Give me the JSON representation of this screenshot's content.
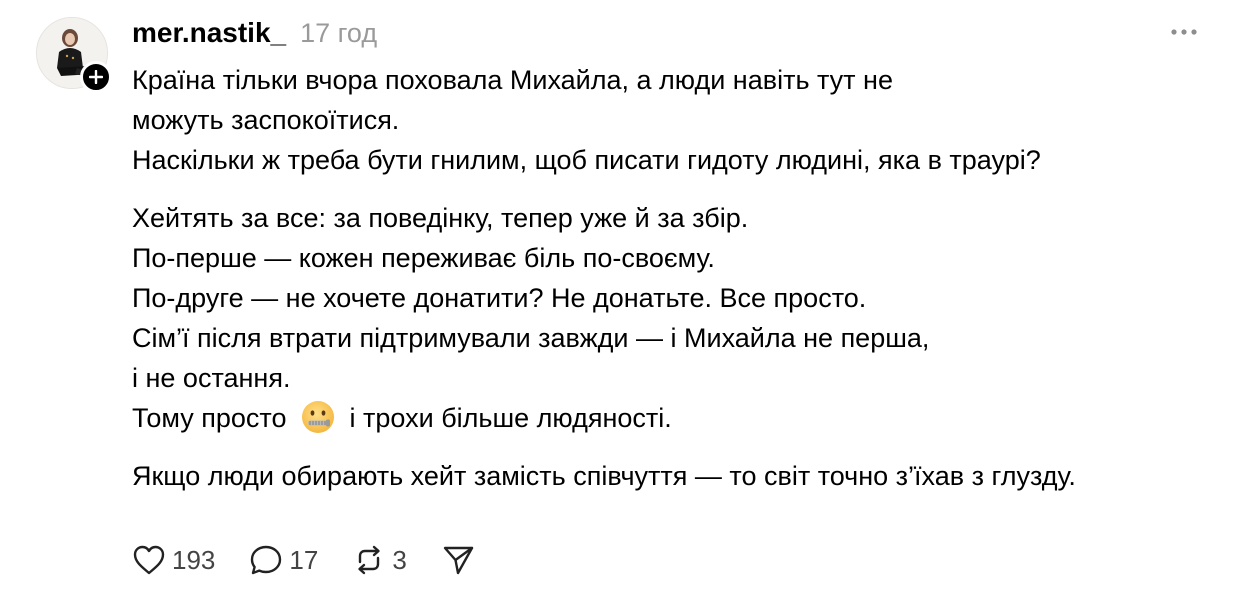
{
  "post": {
    "username": "mer.nastik_",
    "timestamp": "17 год",
    "avatar_icon": "profile-photo",
    "follow_icon": "plus-icon",
    "more_icon": "ellipsis-icon",
    "body_lines": [
      "Країна тільки вчора поховала Михайла, а люди навіть тут не",
      "можуть заспокоїтися.",
      "Наскільки ж треба бути гнилим, щоб писати гидоту людині, яка в траурі?",
      "Хейтять за все: за поведінку, тепер уже й за збір.",
      "По-перше — кожен переживає біль по-своєму.",
      "По-друге — не хочете донатити? Не донатьте. Все просто.",
      "Сім’ї після втрати підтримували завжди — і Михайла не перша,",
      "і не остання.",
      "Тому просто",
      "і трохи більше людяності.",
      "Якщо люди обирають хейт замість співчуття — то світ точно з’їхав з глузду."
    ],
    "emoji_icon": "zipper-mouth-face-emoji"
  },
  "actions": {
    "like_count": "193",
    "reply_count": "17",
    "repost_count": "3",
    "like_icon": "heart-icon",
    "reply_icon": "comment-bubble-icon",
    "repost_icon": "repost-icon",
    "share_icon": "send-icon"
  }
}
